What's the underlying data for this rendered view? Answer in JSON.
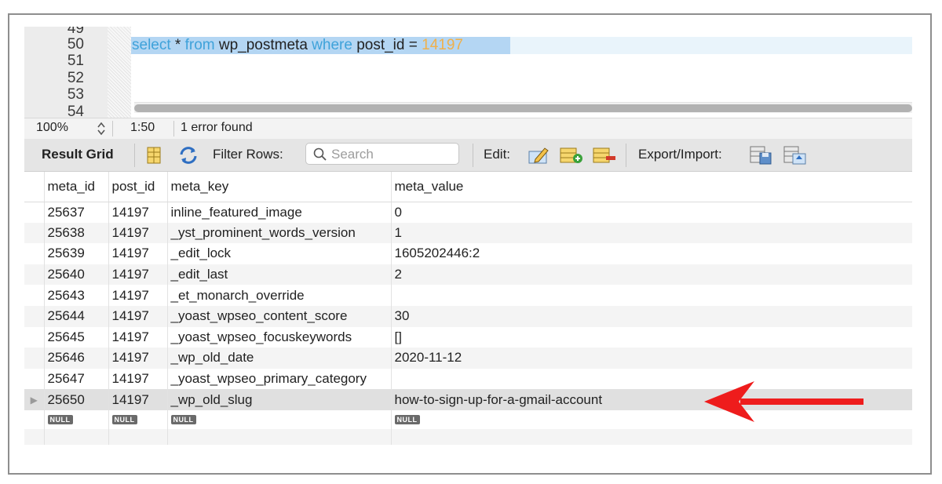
{
  "editor": {
    "line_numbers": [
      "49",
      "50",
      "51",
      "52",
      "53",
      "54"
    ],
    "query": {
      "kw_select": "select",
      "star": " * ",
      "kw_from": "from",
      "table": " wp_postmeta ",
      "kw_where": "where",
      "condition": " post_id = ",
      "value": "14197"
    }
  },
  "statusbar": {
    "zoom": "100%",
    "cursor_position": "1:50",
    "message": "1 error found"
  },
  "toolbar": {
    "result_grid_label": "Result Grid",
    "filter_label": "Filter Rows:",
    "search_placeholder": "Search",
    "edit_label": "Edit:",
    "export_label": "Export/Import:"
  },
  "grid": {
    "columns": [
      "meta_id",
      "post_id",
      "meta_key",
      "meta_value"
    ],
    "rows": [
      [
        "25637",
        "14197",
        "inline_featured_image",
        "0"
      ],
      [
        "25638",
        "14197",
        "_yst_prominent_words_version",
        "1"
      ],
      [
        "25639",
        "14197",
        "_edit_lock",
        "1605202446:2"
      ],
      [
        "25640",
        "14197",
        "_edit_last",
        "2"
      ],
      [
        "25643",
        "14197",
        "_et_monarch_override",
        ""
      ],
      [
        "25644",
        "14197",
        "_yoast_wpseo_content_score",
        "30"
      ],
      [
        "25645",
        "14197",
        "_yoast_wpseo_focuskeywords",
        "[]"
      ],
      [
        "25646",
        "14197",
        "_wp_old_date",
        "2020-11-12"
      ],
      [
        "25647",
        "14197",
        "_yoast_wpseo_primary_category",
        ""
      ],
      [
        "25650",
        "14197",
        "_wp_old_slug",
        "how-to-sign-up-for-a-gmail-account"
      ]
    ],
    "null_label": "NULL",
    "selected_row_marker": "▶"
  },
  "colors": {
    "keyword": "#3fa2da",
    "number": "#f0b04a",
    "selection": "#b4d6f3",
    "arrow": "#ee1c1c"
  }
}
